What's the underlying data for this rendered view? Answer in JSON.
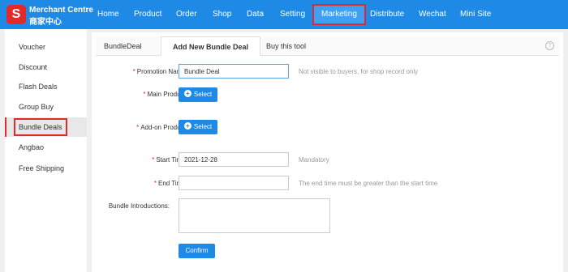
{
  "brand": {
    "mark": "S",
    "name": "Merchant Centre",
    "name_cn": "商家中心"
  },
  "nav": [
    {
      "label": "Home"
    },
    {
      "label": "Product"
    },
    {
      "label": "Order"
    },
    {
      "label": "Shop"
    },
    {
      "label": "Data"
    },
    {
      "label": "Setting"
    },
    {
      "label": "Marketing"
    },
    {
      "label": "Distribute"
    },
    {
      "label": "Wechat"
    },
    {
      "label": "Mini Site"
    }
  ],
  "sidebar": {
    "items": [
      {
        "label": "Voucher"
      },
      {
        "label": "Discount"
      },
      {
        "label": "Flash Deals"
      },
      {
        "label": "Group Buy"
      },
      {
        "label": "Bundle Deals"
      },
      {
        "label": "Angbao"
      },
      {
        "label": "Free Shipping"
      }
    ]
  },
  "tabs": [
    {
      "label": "BundleDeal"
    },
    {
      "label": "Add New Bundle Deal"
    },
    {
      "label": "Buy this tool"
    }
  ],
  "help_icon": "?",
  "form": {
    "promotion_name": {
      "label": "Promotion Name:",
      "value": "Bundle Deal",
      "hint": "Not visible to buyers, for shop record only"
    },
    "main_product": {
      "label": "Main Product:",
      "button": "Select"
    },
    "addon_product": {
      "label": "Add-on Product:",
      "button": "Select"
    },
    "start_time": {
      "label": "Start Time:",
      "value": "2021-12-28",
      "hint": "Mandatory"
    },
    "end_time": {
      "label": "End Time:",
      "value": "",
      "hint": "The end time must be greater than the start time"
    },
    "introductions": {
      "label": "Bundle Introductions:",
      "value": ""
    },
    "confirm": "Confirm"
  },
  "colors": {
    "primary": "#1e8ae6",
    "brand_red": "#e32a2a"
  }
}
